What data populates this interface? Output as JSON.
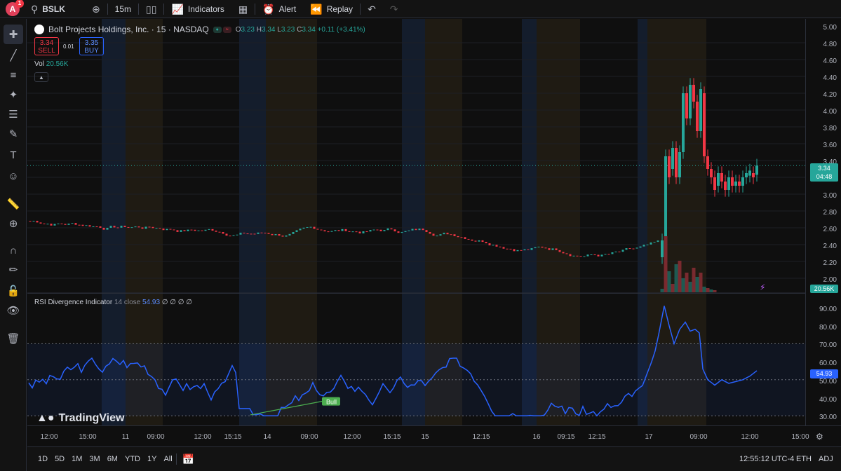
{
  "topbar": {
    "avatar_letter": "A",
    "avatar_badge": "1",
    "symbol": "BSLK",
    "interval": "15m",
    "indicators_label": "Indicators",
    "alert_label": "Alert",
    "replay_label": "Replay"
  },
  "legend": {
    "title": "Bolt Projects Holdings, Inc. · 15 · NASDAQ",
    "o_label": "O",
    "o": "3.23",
    "h_label": "H",
    "h": "3.34",
    "l_label": "L",
    "l": "3.23",
    "c_label": "C",
    "c": "3.34",
    "change": "+0.11 (+3.41%)",
    "sell_price": "3.34",
    "sell_label": "SELL",
    "buy_price": "3.35",
    "buy_label": "BUY",
    "spread": "0.01",
    "vol_label": "Vol",
    "vol_value": "20.56K"
  },
  "rsi": {
    "label": "RSI Divergence Indicator",
    "params": "14 close",
    "value": "54.93",
    "extras": "∅ ∅ ∅ ∅",
    "bull_label": "Bull"
  },
  "price_axis": {
    "labels": [
      "5.00",
      "4.80",
      "4.60",
      "4.40",
      "4.20",
      "4.00",
      "3.80",
      "3.60",
      "3.40",
      "3.20",
      "3.00",
      "2.80",
      "2.60",
      "2.40",
      "2.20",
      "2.00"
    ],
    "current_price": "3.34",
    "countdown": "04:48",
    "volume_tag": "20.56K"
  },
  "rsi_axis": {
    "labels": [
      "90.00",
      "80.00",
      "70.00",
      "60.00",
      "50.00",
      "40.00",
      "30.00"
    ],
    "current": "54.93"
  },
  "time_axis": {
    "labels": [
      "12:00",
      "15:00",
      "11",
      "09:00",
      "12:00",
      "15:15",
      "14",
      "09:00",
      "12:00",
      "15:15",
      "15",
      "12:15",
      "16",
      "09:15",
      "12:15",
      "17",
      "09:00",
      "12:00",
      "15:00"
    ]
  },
  "bottombar": {
    "ranges": [
      "1D",
      "5D",
      "1M",
      "3M",
      "6M",
      "YTD",
      "1Y",
      "All"
    ],
    "clock": "12:55:12 UTC-4",
    "session": "ETH",
    "adj": "ADJ"
  },
  "branding": {
    "name": "TradingView"
  },
  "colors": {
    "up": "#26a69a",
    "down": "#f23645",
    "rsi_line": "#2962ff",
    "accent": "#2962ff"
  },
  "chart_data": {
    "type": "line",
    "title": "Bolt Projects Holdings, Inc. · 15 · NASDAQ",
    "ylim": [
      2.0,
      5.0
    ],
    "rsi_ylim": [
      30,
      90
    ]
  }
}
